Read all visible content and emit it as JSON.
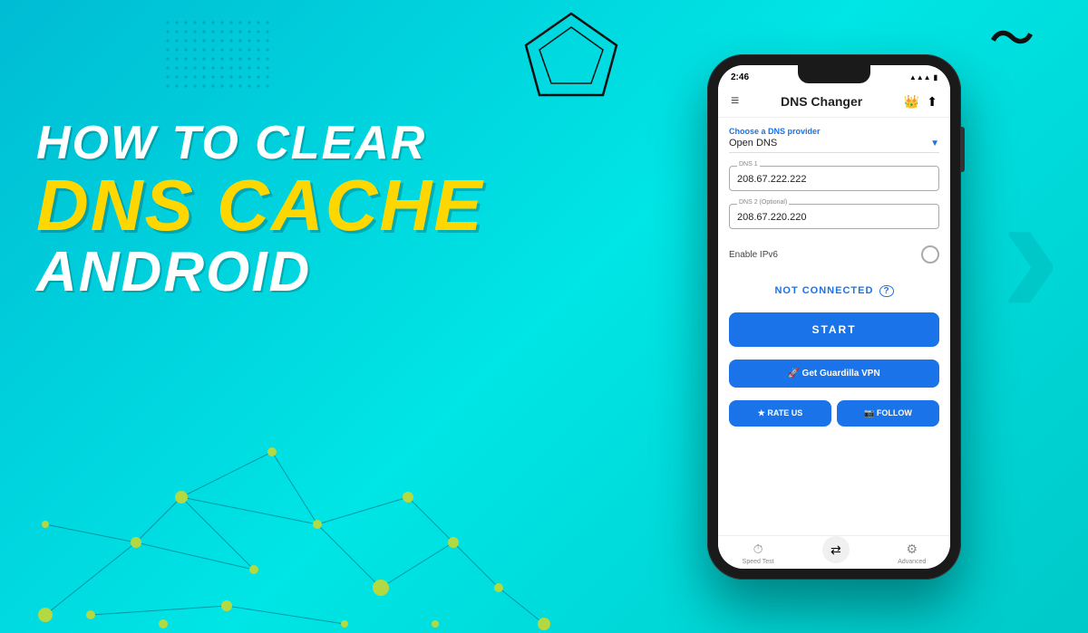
{
  "background": {
    "color": "#00c9c9"
  },
  "headline": {
    "line1": "HOW TO CLEAR",
    "line2": "DNS CACHE",
    "line3": "ANDROID"
  },
  "phone": {
    "status_time": "2:46",
    "status_icons": "📶 🔋",
    "app_title": "DNS Changer",
    "dns_provider_label": "Choose a DNS provider",
    "dns_provider_value": "Open DNS",
    "dns1_label": "DNS 1",
    "dns1_value": "208.67.222.222",
    "dns2_label": "DNS 2 (Optional)",
    "dns2_value": "208.67.220.220",
    "ipv6_label": "Enable IPv6",
    "connection_status": "NOT CONNECTED",
    "start_button": "START",
    "vpn_button": "🚀 Get Guardilla VPN",
    "rate_button": "★ RATE US",
    "follow_button": "📷 FOLLOW",
    "nav_speed_test": "Speed Test",
    "nav_advanced": "Advanced"
  }
}
